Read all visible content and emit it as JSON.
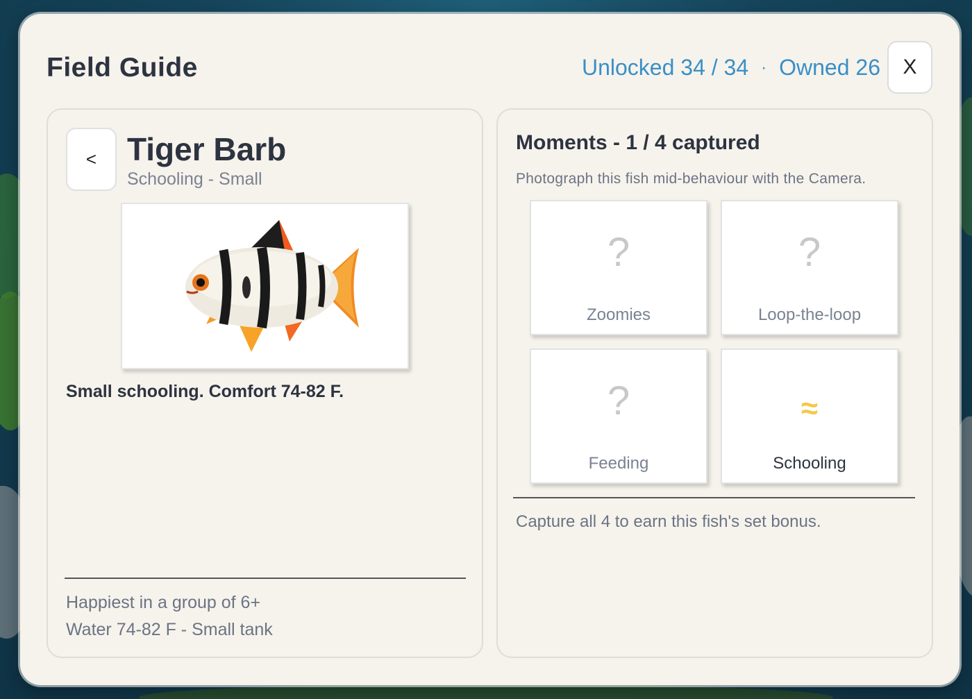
{
  "modal": {
    "title": "Field Guide",
    "unlocked": "Unlocked 34 / 34",
    "separator": "·",
    "owned": "Owned 26",
    "close_label": "X"
  },
  "fish": {
    "back_label": "<",
    "name": "Tiger Barb",
    "subtitle": "Schooling - Small",
    "description": "Small schooling. Comfort 74-82 F.",
    "facts": [
      "Happiest in a group of 6+",
      "Water 74-82 F - Small tank"
    ]
  },
  "moments": {
    "title": "Moments - 1 / 4 captured",
    "hint": "Photograph this fish mid-behaviour with the Camera.",
    "items": [
      {
        "label": "Zoomies",
        "glyph": "?",
        "captured": false
      },
      {
        "label": "Loop-the-loop",
        "glyph": "?",
        "captured": false
      },
      {
        "label": "Feeding",
        "glyph": "?",
        "captured": false
      },
      {
        "label": "Schooling",
        "glyph": "≈",
        "captured": true
      }
    ],
    "bonus": "Capture all 4 to earn this fish's set bonus."
  },
  "colors": {
    "accent": "#3a8fc6",
    "captured_glyph": "#f1c94a",
    "panel_bg": "#f6f3ec"
  }
}
